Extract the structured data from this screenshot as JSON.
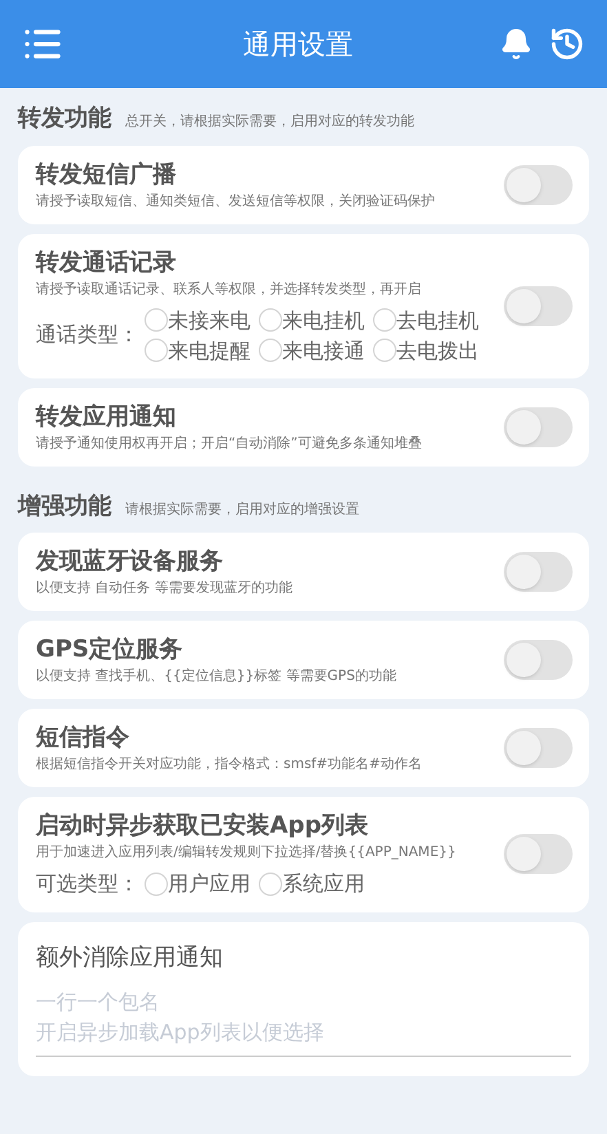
{
  "header": {
    "title": "通用设置"
  },
  "sections": [
    {
      "title": "转发功能",
      "subtitle": "总开关，请根据实际需要，启用对应的转发功能",
      "cards": [
        {
          "kind": "switch",
          "title": "转发短信广播",
          "description": "请授予读取短信、通知类短信、发送短信等权限，关闭验证码保护",
          "on": false
        },
        {
          "kind": "switch",
          "title": "转发通话记录",
          "description": "请授予读取通话记录、联系人等权限，并选择转发类型，再开启",
          "on": false,
          "options_label": "通话类型：",
          "options": [
            {
              "label": "未接来电",
              "selected": false
            },
            {
              "label": "来电挂机",
              "selected": false
            },
            {
              "label": "去电挂机",
              "selected": false
            },
            {
              "label": "来电提醒",
              "selected": false
            },
            {
              "label": "来电接通",
              "selected": false
            },
            {
              "label": "去电拨出",
              "selected": false
            }
          ]
        },
        {
          "kind": "switch",
          "title": "转发应用通知",
          "description": "请授予通知使用权再开启；开启“自动消除”可避免多条通知堆叠",
          "on": false
        }
      ]
    },
    {
      "title": "增强功能",
      "subtitle": "请根据实际需要，启用对应的增强设置",
      "cards": [
        {
          "kind": "switch",
          "title": "发现蓝牙设备服务",
          "description": "以便支持 自动任务 等需要发现蓝牙的功能",
          "on": false
        },
        {
          "kind": "switch",
          "title": "GPS定位服务",
          "description": "以便支持 查找手机、{{定位信息}}标签 等需要GPS的功能",
          "on": false
        },
        {
          "kind": "switch",
          "title": "短信指令",
          "description": "根据短信指令开关对应功能，指令格式：smsf#功能名#动作名",
          "on": false
        },
        {
          "kind": "switch",
          "title": "启动时异步获取已安装App列表",
          "description": "用于加速进入应用列表/编辑转发规则下拉选择/替换{{APP_NAME}}",
          "on": false,
          "options_label": "可选类型：",
          "options": [
            {
              "label": "用户应用",
              "selected": false
            },
            {
              "label": "系统应用",
              "selected": false
            }
          ]
        },
        {
          "kind": "textarea",
          "title": "额外消除应用通知",
          "placeholder": [
            "一行一个包名",
            "开启异步加载App列表以便选择"
          ]
        }
      ]
    }
  ]
}
